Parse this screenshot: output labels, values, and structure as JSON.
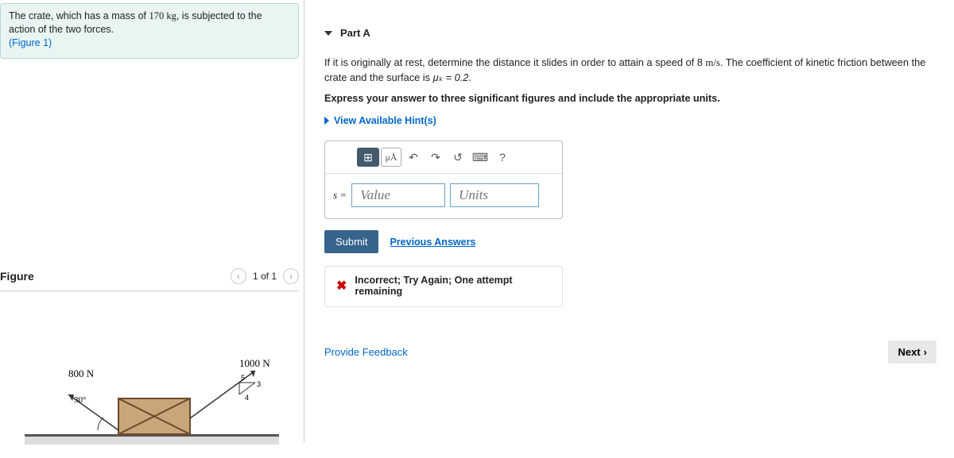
{
  "prompt": {
    "line1a": "The crate, which has a mass of ",
    "mass": "170 kg",
    "line1b": ", is subjected to the action of the two forces.",
    "figlink": "(Figure 1)"
  },
  "figure": {
    "title": "Figure",
    "page": "1 of 1",
    "labels": {
      "f1": "800 N",
      "angle": "30°",
      "f2": "1000 N",
      "t5": "5",
      "t3": "3",
      "t4": "4"
    }
  },
  "part": {
    "id": "Part A",
    "q1": "If it is originally at rest, determine the distance it slides in order to attain a speed of 8 ",
    "unit1": "m/s",
    "q2": ". The coefficient of kinetic friction between the crate and the surface is ",
    "muk": "μₖ = 0.2",
    "q3": ".",
    "instruct": "Express your answer to three significant figures and include the appropriate units.",
    "hints": "View Available Hint(s)"
  },
  "toolbar": {
    "templates": "⊞",
    "special": "μÅ",
    "undo": "↶",
    "redo": "↷",
    "reset": "↺",
    "kbd": "⌨",
    "help": "?"
  },
  "answer": {
    "var": "s =",
    "value_ph": "Value",
    "units_ph": "Units"
  },
  "buttons": {
    "submit": "Submit",
    "prev": "Previous Answers",
    "feedback": "Incorrect; Try Again; One attempt remaining",
    "provide": "Provide Feedback",
    "next": "Next"
  }
}
